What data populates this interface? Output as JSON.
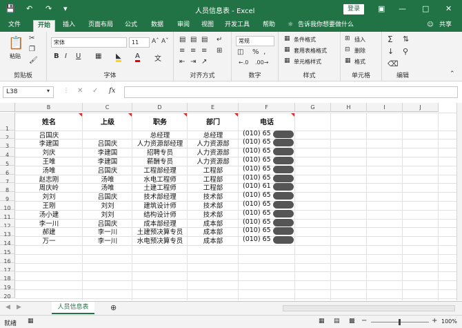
{
  "app": {
    "title": "人员信息表 - Excel",
    "login": "登录",
    "tell_me": "告诉我你想要做什么",
    "share": "共享"
  },
  "tabs": [
    "文件",
    "开始",
    "插入",
    "页面布局",
    "公式",
    "数据",
    "审阅",
    "视图",
    "开发工具",
    "帮助"
  ],
  "ribbon": {
    "clipboard": {
      "label": "剪贴板",
      "paste": "粘贴"
    },
    "font": {
      "label": "字体",
      "name": "宋体",
      "size": "11",
      "bold": "B",
      "italic": "I",
      "underline": "U"
    },
    "alignment": {
      "label": "对齐方式"
    },
    "number": {
      "label": "数字",
      "format": "常规",
      "percent": "%"
    },
    "styles": {
      "label": "样式",
      "conditional": "条件格式",
      "table": "套用表格格式",
      "cell": "单元格样式"
    },
    "cells": {
      "label": "单元格",
      "insert": "插入",
      "delete": "删除",
      "format": "格式"
    },
    "editing": {
      "label": "编辑"
    }
  },
  "formula_bar": {
    "name_box": "L38",
    "fx": "fx",
    "value": ""
  },
  "columns": [
    "B",
    "C",
    "D",
    "E",
    "F",
    "G",
    "H",
    "I",
    "J"
  ],
  "rows": [
    "1",
    "2",
    "3",
    "4",
    "5",
    "6",
    "7",
    "8",
    "9",
    "10",
    "11",
    "12",
    "13",
    "14",
    "15",
    "16",
    "17",
    "18",
    "19",
    "20"
  ],
  "headers": [
    "姓名",
    "上级",
    "职务",
    "部门",
    "电话"
  ],
  "data": [
    [
      "吕国庆",
      "",
      "总经理",
      "总经理",
      "(010) 65"
    ],
    [
      "李建国",
      "吕国庆",
      "人力资源部经理",
      "人力资源部",
      "(010) 65"
    ],
    [
      "刘庆",
      "李建国",
      "招聘专员",
      "人力资源部",
      "(010) 65"
    ],
    [
      "王唯",
      "李建国",
      "薪酬专员",
      "人力资源部",
      "(010) 65"
    ],
    [
      "汤唯",
      "吕国庆",
      "工程部经理",
      "工程部",
      "(010) 65"
    ],
    [
      "赵志刚",
      "汤唯",
      "水电工程师",
      "工程部",
      "(010) 65"
    ],
    [
      "周庆岭",
      "汤唯",
      "土建工程师",
      "工程部",
      "(010) 61"
    ],
    [
      "刘刘",
      "吕国庆",
      "技术部经理",
      "技术部",
      "(010) 65"
    ],
    [
      "王刚",
      "刘刘",
      "建筑设计师",
      "技术部",
      "(010) 65"
    ],
    [
      "汤小建",
      "刘刘",
      "结构设计师",
      "技术部",
      "(010) 65"
    ],
    [
      "李一川",
      "吕国庆",
      "成本部经理",
      "成本部",
      "(010) 65"
    ],
    [
      "郝建",
      "李一川",
      "土建预决算专员",
      "成本部",
      "(010) 65"
    ],
    [
      "万一",
      "李一川",
      "水电预决算专员",
      "成本部",
      "(010) 65"
    ]
  ],
  "sheet_tab": "人员信息表",
  "status": {
    "ready": "就绪",
    "zoom": "100%"
  }
}
